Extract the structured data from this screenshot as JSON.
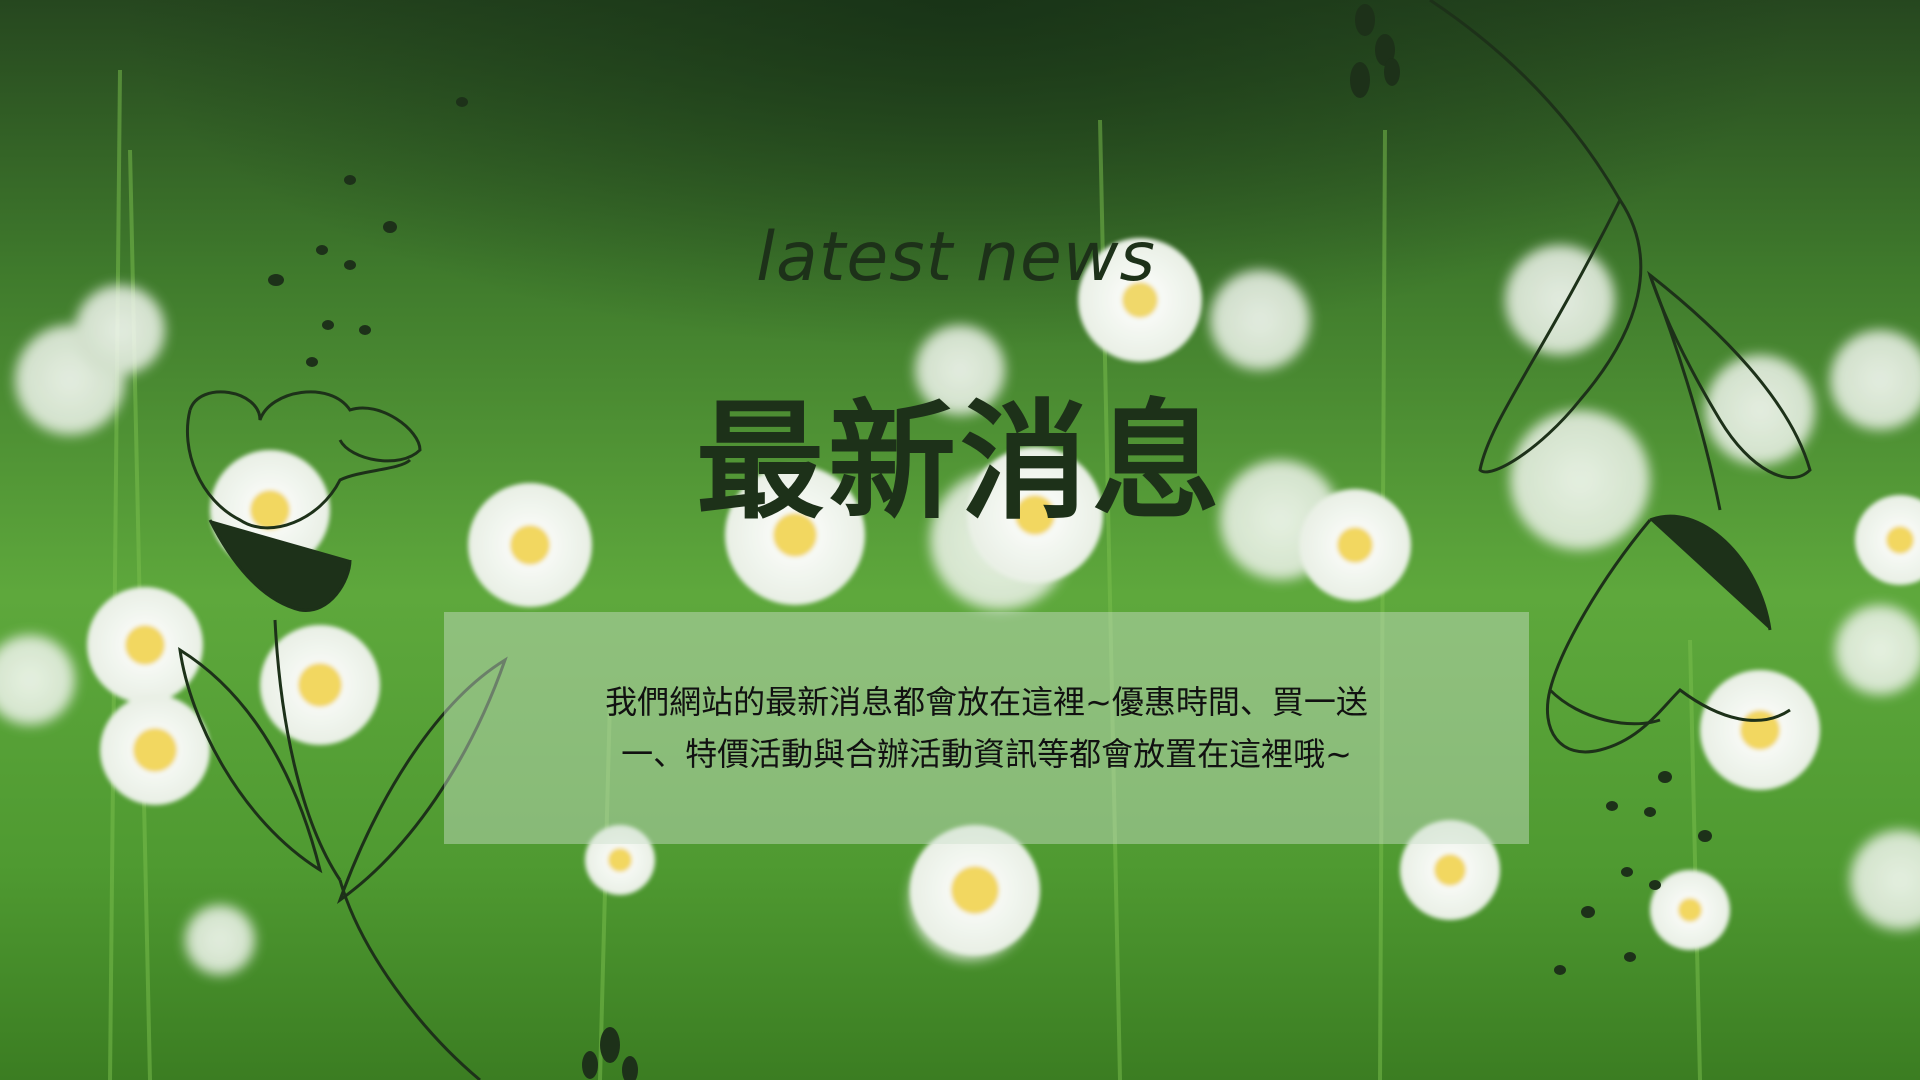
{
  "header": {
    "subtitle": "latest news",
    "title": "最新消息"
  },
  "content": {
    "line1": "我們網站的最新消息都會放在這裡~優惠時間、買一送",
    "line2": "一、特價活動與合辦活動資訊等都會放置在這裡哦~"
  },
  "colors": {
    "text_dark": "#1d3119",
    "box": "#cde1cd",
    "grass": "#5ea83c"
  },
  "icons": [
    "line-art-flower-left-icon",
    "line-art-flower-right-icon",
    "leaf-sprig-icon",
    "dot-trail-icon"
  ]
}
